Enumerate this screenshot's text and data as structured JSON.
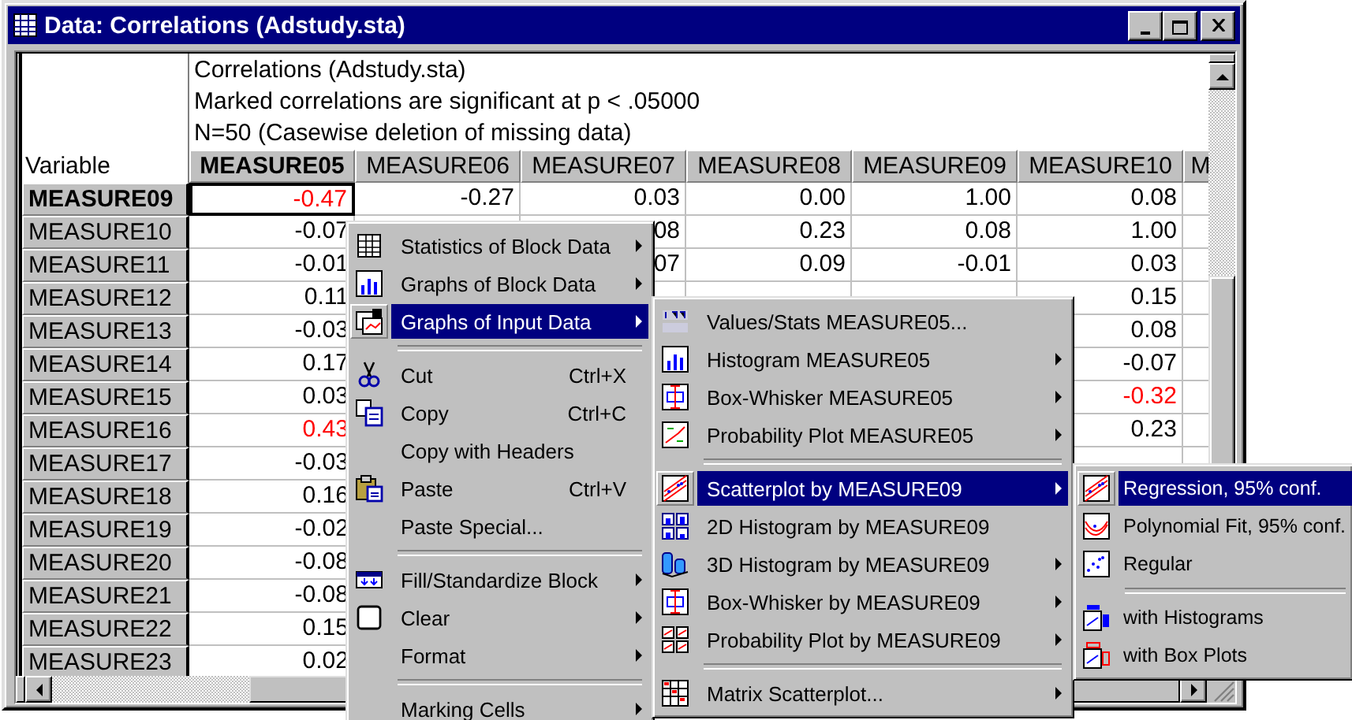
{
  "window": {
    "title": "Data: Correlations (Adstudy.sta)"
  },
  "table": {
    "notes": [
      "Correlations (Adstudy.sta)",
      "Marked correlations are significant at p < .05000",
      "N=50 (Casewise deletion of missing data)"
    ],
    "corner_label": "Variable",
    "columns": [
      {
        "label": "MEASURE05",
        "selected": true
      },
      {
        "label": "MEASURE06",
        "selected": false
      },
      {
        "label": "MEASURE07",
        "selected": false
      },
      {
        "label": "MEASURE08",
        "selected": false
      },
      {
        "label": "MEASURE09",
        "selected": false
      },
      {
        "label": "MEASURE10",
        "selected": false
      },
      {
        "label": "M",
        "selected": false
      }
    ],
    "rows": [
      {
        "name": "MEASURE09",
        "selected": true,
        "cells": [
          {
            "text": "-0.47",
            "marked": true
          },
          {
            "text": "-0.27",
            "marked": false
          },
          {
            "text": "0.03",
            "marked": false
          },
          {
            "text": "0.00",
            "marked": false
          },
          {
            "text": "1.00",
            "marked": false
          },
          {
            "text": "0.08",
            "marked": false
          }
        ]
      },
      {
        "name": "MEASURE10",
        "selected": false,
        "cells": [
          {
            "text": "-0.07",
            "marked": false
          },
          null,
          {
            "text": "08",
            "marked": false
          },
          {
            "text": "0.23",
            "marked": false
          },
          {
            "text": "0.08",
            "marked": false
          },
          {
            "text": "1.00",
            "marked": false
          }
        ]
      },
      {
        "name": "MEASURE11",
        "selected": false,
        "cells": [
          {
            "text": "-0.01",
            "marked": false
          },
          null,
          {
            "text": "07",
            "marked": false
          },
          {
            "text": "0.09",
            "marked": false
          },
          {
            "text": "-0.01",
            "marked": false
          },
          {
            "text": "0.03",
            "marked": false
          }
        ]
      },
      {
        "name": "MEASURE12",
        "selected": false,
        "cells": [
          {
            "text": "0.11",
            "marked": false
          },
          null,
          null,
          null,
          null,
          {
            "text": "0.15",
            "marked": false
          }
        ]
      },
      {
        "name": "MEASURE13",
        "selected": false,
        "cells": [
          {
            "text": "-0.03",
            "marked": false
          },
          null,
          null,
          null,
          null,
          {
            "text": "0.08",
            "marked": false
          }
        ]
      },
      {
        "name": "MEASURE14",
        "selected": false,
        "cells": [
          {
            "text": "0.17",
            "marked": false
          },
          null,
          null,
          null,
          null,
          {
            "text": "-0.07",
            "marked": false
          }
        ]
      },
      {
        "name": "MEASURE15",
        "selected": false,
        "cells": [
          {
            "text": "0.03",
            "marked": false
          },
          null,
          null,
          null,
          null,
          {
            "text": "-0.32",
            "marked": true
          }
        ]
      },
      {
        "name": "MEASURE16",
        "selected": false,
        "cells": [
          {
            "text": "0.43",
            "marked": true
          },
          null,
          null,
          null,
          null,
          {
            "text": "0.23",
            "marked": false
          }
        ]
      },
      {
        "name": "MEASURE17",
        "selected": false,
        "cells": [
          {
            "text": "-0.03",
            "marked": false
          }
        ]
      },
      {
        "name": "MEASURE18",
        "selected": false,
        "cells": [
          {
            "text": "0.16",
            "marked": false
          }
        ]
      },
      {
        "name": "MEASURE19",
        "selected": false,
        "cells": [
          {
            "text": "-0.02",
            "marked": false
          }
        ]
      },
      {
        "name": "MEASURE20",
        "selected": false,
        "cells": [
          {
            "text": "-0.08",
            "marked": false
          }
        ]
      },
      {
        "name": "MEASURE21",
        "selected": false,
        "cells": [
          {
            "text": "-0.08",
            "marked": false
          }
        ]
      },
      {
        "name": "MEASURE22",
        "selected": false,
        "cells": [
          {
            "text": "0.15",
            "marked": false
          }
        ]
      },
      {
        "name": "MEASURE23",
        "selected": false,
        "cells": [
          {
            "text": "0.02",
            "marked": false
          }
        ]
      }
    ]
  },
  "menus": [
    {
      "items": [
        {
          "kind": "item",
          "label": "Statistics of Block Data",
          "submenu": true,
          "selected": false
        },
        {
          "kind": "item",
          "label": "Graphs of Block Data",
          "submenu": true,
          "selected": false
        },
        {
          "kind": "item",
          "label": "Graphs of Input Data",
          "submenu": true,
          "selected": true
        },
        {
          "kind": "separator"
        },
        {
          "kind": "item",
          "label": "Cut",
          "shortcut": "Ctrl+X",
          "submenu": false,
          "selected": false
        },
        {
          "kind": "item",
          "label": "Copy",
          "shortcut": "Ctrl+C",
          "submenu": false,
          "selected": false
        },
        {
          "kind": "item",
          "label": "Copy with Headers",
          "submenu": false,
          "selected": false
        },
        {
          "kind": "item",
          "label": "Paste",
          "shortcut": "Ctrl+V",
          "submenu": false,
          "selected": false
        },
        {
          "kind": "item",
          "label": "Paste Special...",
          "submenu": false,
          "selected": false
        },
        {
          "kind": "separator"
        },
        {
          "kind": "item",
          "label": "Fill/Standardize Block",
          "submenu": true,
          "selected": false
        },
        {
          "kind": "item",
          "label": "Clear",
          "submenu": true,
          "selected": false
        },
        {
          "kind": "item",
          "label": "Format",
          "submenu": true,
          "selected": false
        },
        {
          "kind": "separator"
        },
        {
          "kind": "item",
          "label": "Marking Cells",
          "submenu": true,
          "selected": false
        }
      ]
    },
    {
      "items": [
        {
          "kind": "item",
          "label": "Values/Stats MEASURE05...",
          "submenu": false,
          "selected": false
        },
        {
          "kind": "item",
          "label": "Histogram MEASURE05",
          "submenu": true,
          "selected": false
        },
        {
          "kind": "item",
          "label": "Box-Whisker MEASURE05",
          "submenu": true,
          "selected": false
        },
        {
          "kind": "item",
          "label": "Probability Plot MEASURE05",
          "submenu": true,
          "selected": false
        },
        {
          "kind": "separator"
        },
        {
          "kind": "item",
          "label": "Scatterplot by MEASURE09",
          "submenu": true,
          "selected": true
        },
        {
          "kind": "item",
          "label": "2D Histogram by MEASURE09",
          "submenu": false,
          "selected": false
        },
        {
          "kind": "item",
          "label": "3D Histogram by MEASURE09",
          "submenu": true,
          "selected": false
        },
        {
          "kind": "item",
          "label": "Box-Whisker by MEASURE09",
          "submenu": true,
          "selected": false
        },
        {
          "kind": "item",
          "label": "Probability Plot by MEASURE09",
          "submenu": true,
          "selected": false
        },
        {
          "kind": "separator"
        },
        {
          "kind": "item",
          "label": "Matrix Scatterplot...",
          "submenu": true,
          "selected": false
        }
      ]
    },
    {
      "items": [
        {
          "kind": "item",
          "label": "Regression, 95% conf.",
          "submenu": false,
          "selected": true
        },
        {
          "kind": "item",
          "label": "Polynomial Fit, 95% conf.",
          "submenu": false,
          "selected": false
        },
        {
          "kind": "item",
          "label": "Regular",
          "submenu": false,
          "selected": false
        },
        {
          "kind": "separator"
        },
        {
          "kind": "item",
          "label": "with Histograms",
          "submenu": false,
          "selected": false
        },
        {
          "kind": "item",
          "label": "with Box Plots",
          "submenu": false,
          "selected": false
        }
      ]
    }
  ]
}
